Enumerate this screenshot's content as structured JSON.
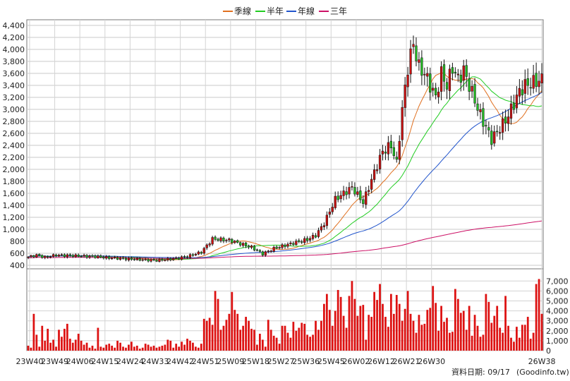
{
  "chart_data": {
    "type": "candlestick",
    "legend": [
      {
        "label": "季線",
        "color": "#e07020"
      },
      {
        "label": "半年",
        "color": "#22cc22"
      },
      {
        "label": "年線",
        "color": "#2255cc"
      },
      {
        "label": "三年",
        "color": "#cc1166"
      }
    ],
    "price_axis": {
      "ylim": [
        400,
        4400
      ],
      "ticks": [
        "4,400",
        "4,200",
        "4,000",
        "3,800",
        "3,600",
        "3,400",
        "3,200",
        "3,000",
        "2,800",
        "2,600",
        "2,400",
        "2,200",
        "2,000",
        "1,800",
        "1,600",
        "1,400",
        "1,200",
        "1,000",
        "800",
        "600",
        "400"
      ]
    },
    "volume_axis": {
      "ylim": [
        0,
        7800
      ],
      "ticks": [
        "7,000",
        "6,000",
        "5,000",
        "4,000",
        "3,000",
        "2,000",
        "1,000",
        "0"
      ]
    },
    "x_ticks": [
      "23W40",
      "23W49",
      "24W06",
      "24W15",
      "24W24",
      "24W33",
      "24W42",
      "24W51",
      "25W09",
      "25W18",
      "25W27",
      "25W36",
      "25W45",
      "26W02",
      "26W12",
      "26W21",
      "26W30",
      "26W38"
    ],
    "date_note": "資料日期: 09/17",
    "source": "(Goodinfo.tw)",
    "close_anchors": [
      [
        0,
        540
      ],
      [
        3,
        570
      ],
      [
        6,
        535
      ],
      [
        10,
        570
      ],
      [
        16,
        560
      ],
      [
        24,
        545
      ],
      [
        30,
        520
      ],
      [
        38,
        500
      ],
      [
        46,
        480
      ],
      [
        54,
        520
      ],
      [
        58,
        560
      ],
      [
        62,
        620
      ],
      [
        66,
        840
      ],
      [
        72,
        820
      ],
      [
        80,
        700
      ],
      [
        84,
        590
      ],
      [
        88,
        680
      ],
      [
        94,
        760
      ],
      [
        100,
        830
      ],
      [
        103,
        900
      ],
      [
        106,
        1100
      ],
      [
        110,
        1500
      ],
      [
        113,
        1600
      ],
      [
        116,
        1700
      ],
      [
        120,
        1450
      ],
      [
        124,
        1950
      ],
      [
        127,
        2300
      ],
      [
        130,
        2400
      ],
      [
        132,
        2100
      ],
      [
        134,
        3000
      ],
      [
        136,
        3700
      ],
      [
        138,
        4100
      ],
      [
        140,
        3700
      ],
      [
        142,
        3600
      ],
      [
        146,
        3200
      ],
      [
        148,
        3600
      ],
      [
        150,
        3400
      ],
      [
        152,
        3700
      ],
      [
        154,
        3500
      ],
      [
        156,
        3650
      ],
      [
        158,
        3400
      ],
      [
        162,
        2900
      ],
      [
        166,
        2500
      ],
      [
        170,
        2750
      ],
      [
        172,
        2900
      ],
      [
        174,
        3100
      ],
      [
        176,
        3300
      ],
      [
        178,
        3400
      ]
    ],
    "volume_values": [
      500,
      300,
      3700,
      1600,
      400,
      2500,
      1000,
      2200,
      800,
      1100,
      400,
      2100,
      1400,
      2200,
      2700,
      1200,
      800,
      1100,
      1700,
      1000,
      600,
      800,
      300,
      500,
      200,
      2300,
      400,
      300,
      600,
      700,
      500,
      300,
      1000,
      800,
      400,
      300,
      600,
      900,
      400,
      500,
      200,
      300,
      700,
      600,
      400,
      500,
      300,
      400,
      500,
      600,
      1100,
      1000,
      300,
      700,
      400,
      900,
      600,
      1200,
      1000,
      800,
      400,
      300,
      700,
      3200,
      3000,
      3300,
      2600,
      6000,
      5200,
      2100,
      2500,
      3100,
      3700,
      5900,
      4100,
      3700,
      2100,
      2500,
      3400,
      3000,
      2200,
      2100,
      600,
      1700,
      1100,
      400,
      3100,
      2100,
      1500,
      1300,
      700,
      2500,
      2500,
      1800,
      1300,
      2900,
      2000,
      2300,
      2800,
      2700,
      1600,
      1400,
      1600,
      3000,
      2100,
      3000,
      4700,
      5700,
      4100,
      2500,
      4000,
      6100,
      5400,
      3500,
      2300,
      5500,
      7000,
      5200,
      3500,
      4500,
      4600,
      1100,
      3600,
      3400,
      5900,
      5100,
      6700,
      4700,
      3400,
      2400,
      5700,
      3700,
      5600,
      4700,
      3000,
      4200,
      6000,
      3700,
      3000,
      1800,
      3600,
      2600,
      2700,
      4100,
      4300,
      6500,
      4800,
      2000,
      4500,
      2900,
      3300,
      1800,
      1900,
      6200,
      5200,
      3800,
      4000,
      2100,
      4500,
      1500,
      3600,
      2500,
      1400,
      1600,
      5700,
      4900,
      2800,
      3500,
      4500,
      2300,
      1800,
      5500,
      2500,
      1300,
      900,
      2400,
      1300,
      2600,
      2600,
      3400,
      1200,
      1800,
      6700,
      7200,
      3700
    ]
  }
}
